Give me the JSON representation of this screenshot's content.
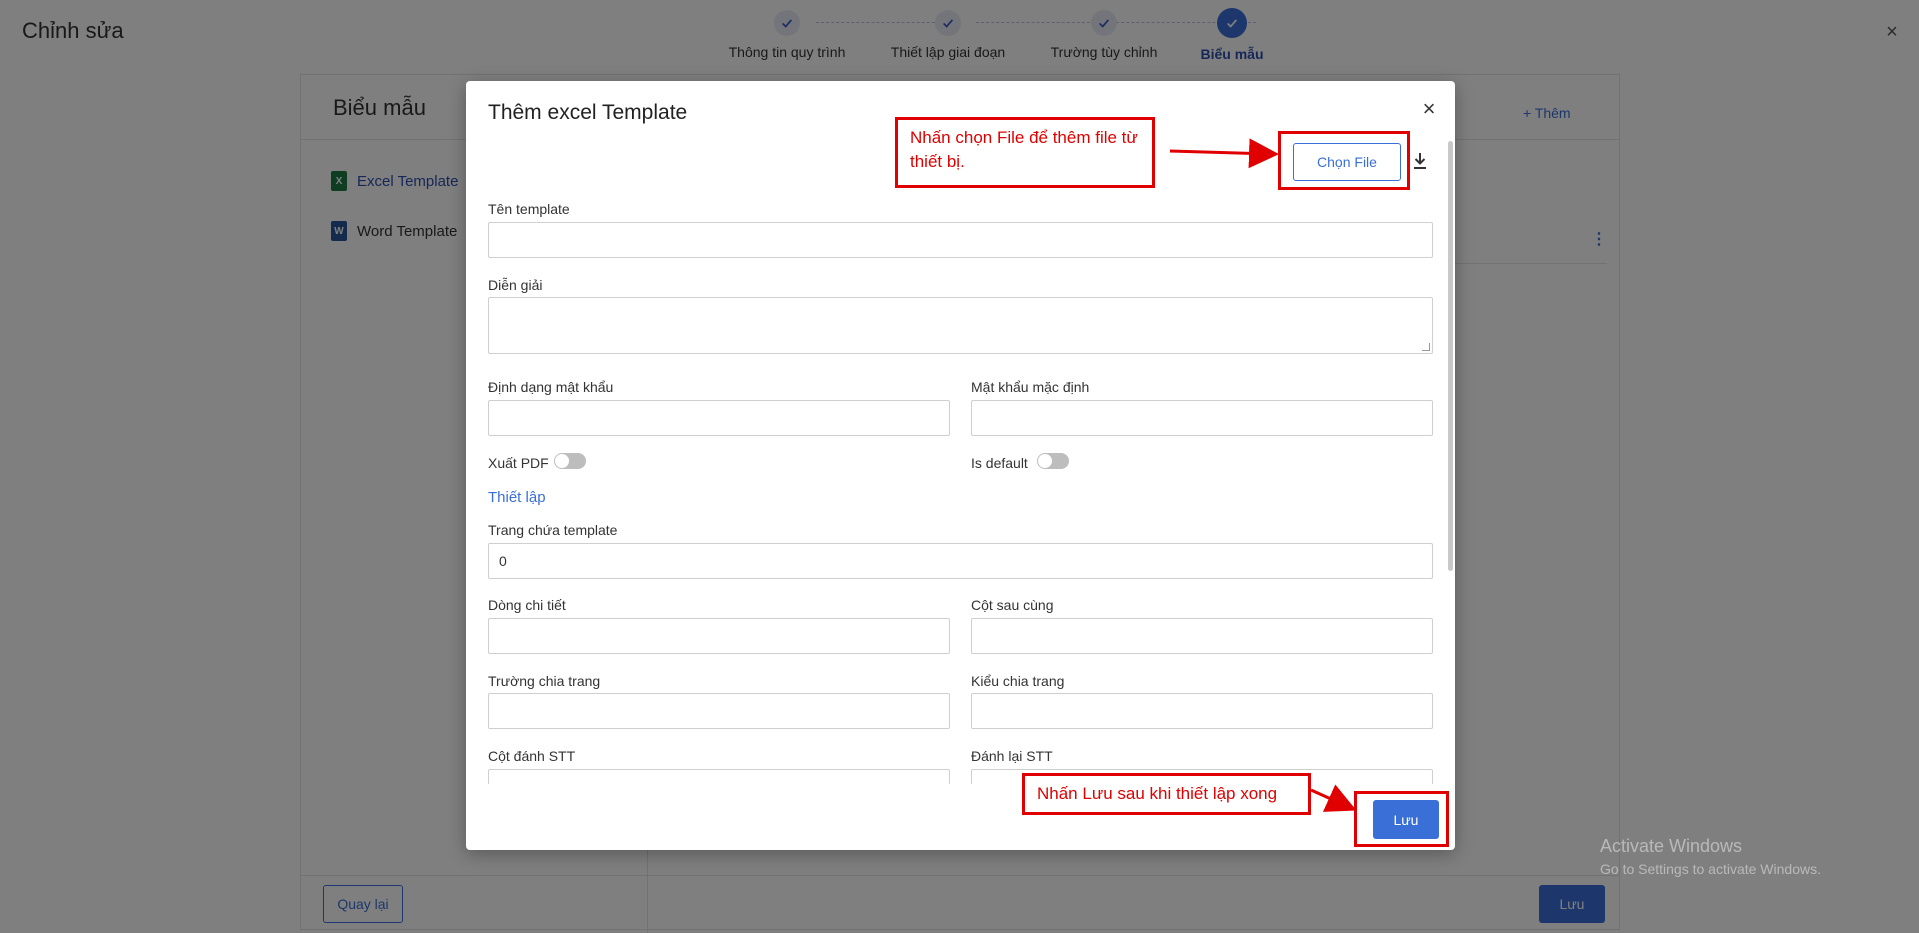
{
  "page": {
    "title": "Chỉnh sửa",
    "close_icon": "×"
  },
  "stepper": {
    "steps": [
      {
        "label": "Thông tin quy trình",
        "state": "done"
      },
      {
        "label": "Thiết lập giai đoạn",
        "state": "done"
      },
      {
        "label": "Trường tùy chỉnh",
        "state": "done"
      },
      {
        "label": "Biểu mẫu",
        "state": "active"
      }
    ]
  },
  "card": {
    "title": "Biểu mẫu",
    "add_label": "+ Thêm",
    "sidebar": [
      {
        "label": "Excel Template",
        "icon": "excel-file-icon",
        "icon_text": "X"
      },
      {
        "label": "Word Template",
        "icon": "word-file-icon",
        "icon_text": "W"
      }
    ],
    "back_label": "Quay lại",
    "save_label": "Lưu",
    "kebab": "⋮"
  },
  "modal": {
    "title": "Thêm excel Template",
    "close": "×",
    "choose_file_label": "Chọn File",
    "fields": {
      "template_name": {
        "label": "Tên template",
        "value": ""
      },
      "description": {
        "label": "Diễn giải",
        "value": ""
      },
      "password_format": {
        "label": "Định dạng mật khẩu",
        "value": ""
      },
      "default_password": {
        "label": "Mật khẩu mặc định",
        "value": ""
      },
      "export_pdf": {
        "label": "Xuất PDF",
        "on": false
      },
      "is_default": {
        "label": "Is default",
        "on": false
      },
      "settings_link": "Thiết lập",
      "template_page": {
        "label": "Trang chứa template",
        "value": "0"
      },
      "detail_row": {
        "label": "Dòng chi tiết",
        "value": ""
      },
      "last_column": {
        "label": "Cột sau cùng",
        "value": ""
      },
      "page_break_field": {
        "label": "Trường chia trang",
        "value": ""
      },
      "page_break_type": {
        "label": "Kiểu chia trang",
        "value": ""
      },
      "index_column": {
        "label": "Cột đánh STT",
        "value": ""
      },
      "reindex": {
        "label": "Đánh lại STT",
        "value": ""
      }
    },
    "save_label": "Lưu"
  },
  "annotations": {
    "choose_file_note": "Nhấn chọn File để thêm file từ thiết bị.",
    "save_note": "Nhấn Lưu sau khi thiết lập xong",
    "color": "#e00000"
  },
  "watermark": {
    "line1": "Activate Windows",
    "line2": "Go to Settings to activate Windows."
  },
  "colors": {
    "primary": "#3a6fd8",
    "overlay": "rgba(0,0,0,0.5)"
  }
}
